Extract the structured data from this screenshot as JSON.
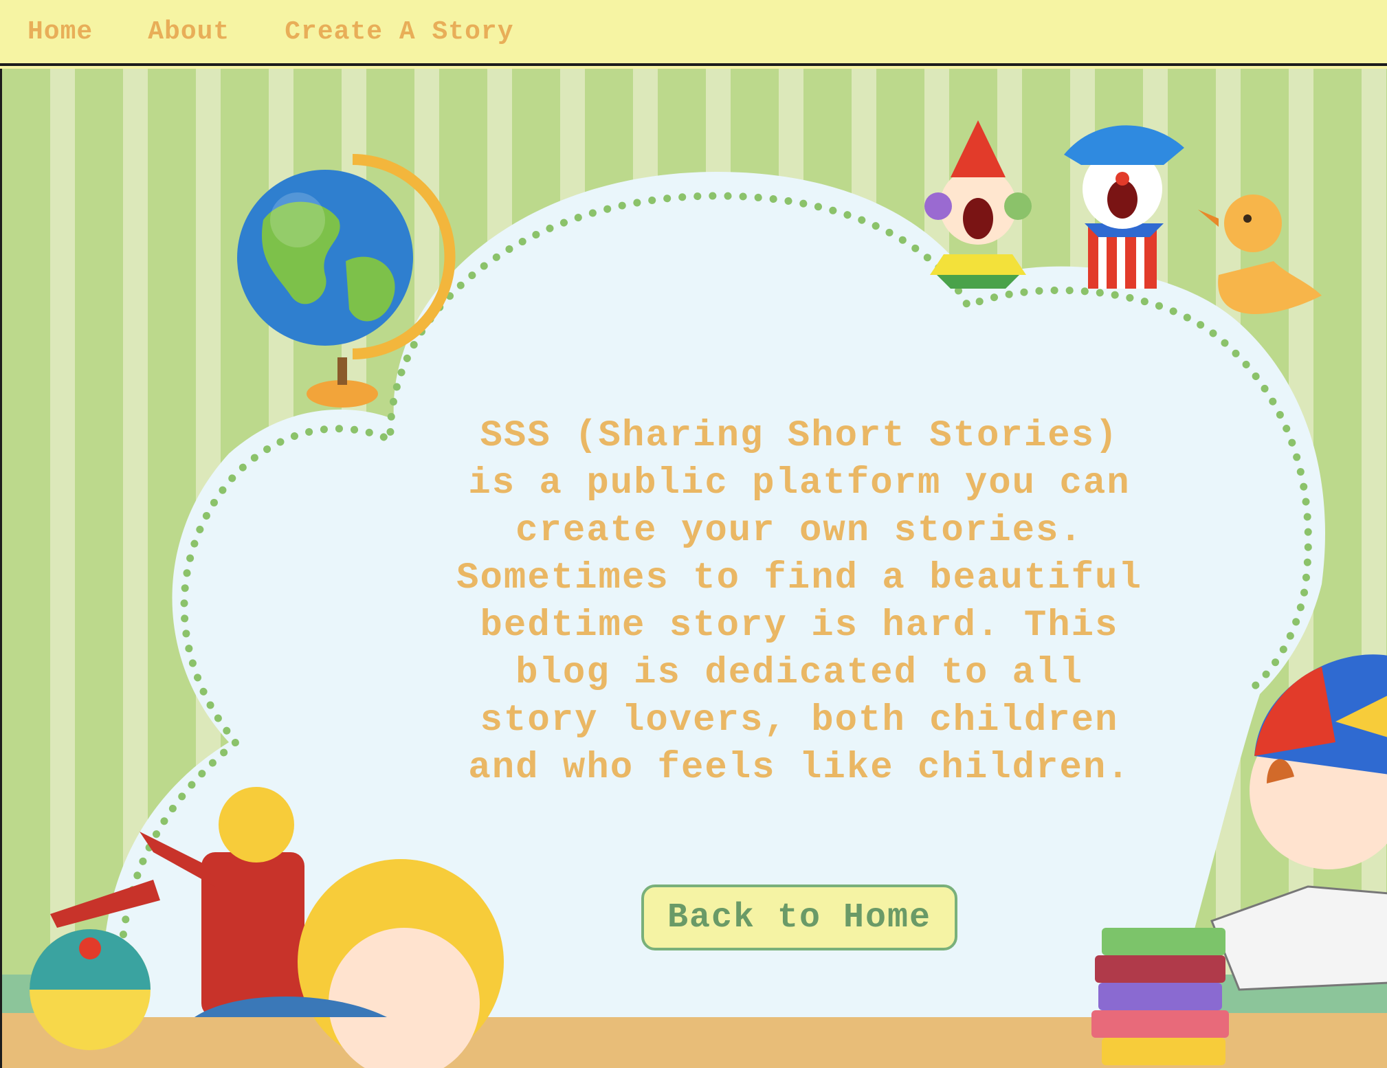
{
  "nav": {
    "items": [
      {
        "label": "Home"
      },
      {
        "label": "About"
      },
      {
        "label": "Create A Story"
      }
    ]
  },
  "about": {
    "description": "SSS (Sharing Short Stories) is a public platform you can create your own stories. Sometimes to find a beautiful bedtime story is hard. This blog is dedicated to all story lovers, both children and who feels like children.",
    "back_button_label": "Back to Home"
  },
  "colors": {
    "nav_bg": "#f6f4a3",
    "nav_text": "#e8ae58",
    "stripe_dark": "#bcd98c",
    "stripe_light": "#dce8ba",
    "cloud_fill": "#eaf6fb",
    "cloud_dots": "#8bc26a",
    "body_text": "#eab764",
    "button_border": "#79b07a",
    "button_text": "#6a9a67",
    "floor": "#e8bd78"
  },
  "illustrations": [
    {
      "name": "globe-illustration"
    },
    {
      "name": "clown-toy-illustration"
    },
    {
      "name": "jester-toy-illustration"
    },
    {
      "name": "duck-toy-illustration"
    },
    {
      "name": "girl-reading-illustration"
    },
    {
      "name": "beach-ball-illustration"
    },
    {
      "name": "boy-reading-illustration"
    },
    {
      "name": "book-stack-illustration"
    }
  ]
}
